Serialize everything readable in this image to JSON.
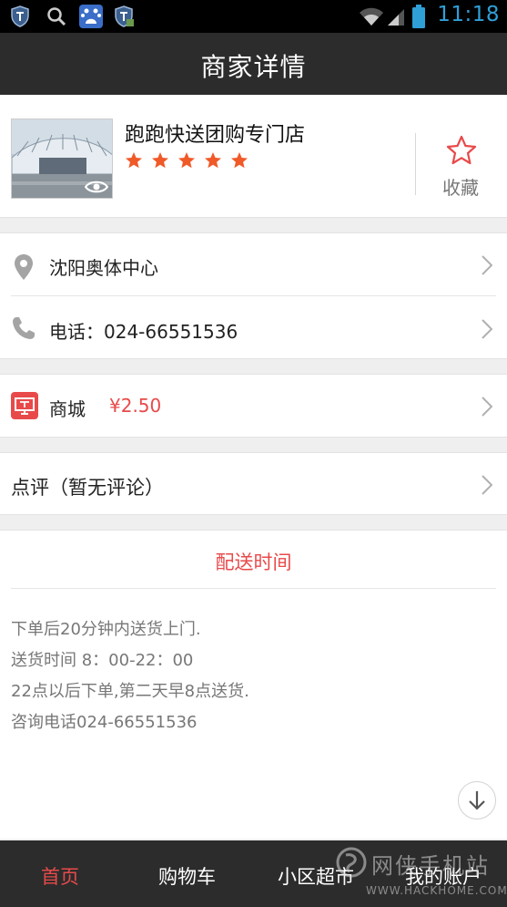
{
  "status_bar": {
    "time": "11:18",
    "left_icons": [
      "shield-icon",
      "search-icon",
      "baidu-icon",
      "shield-app-icon"
    ],
    "right_icons": [
      "wifi-icon",
      "signal-icon",
      "battery-icon"
    ]
  },
  "header": {
    "title": "商家详情"
  },
  "store": {
    "name": "跑跑快送团购专门店",
    "rating_stars": 5,
    "star_color": "#f05a28",
    "favorite_label": "收藏"
  },
  "location": {
    "label": "沈阳奥体中心"
  },
  "phone": {
    "label": "电话：024-66551536"
  },
  "mall": {
    "label": "商城",
    "price": "¥2.50"
  },
  "review": {
    "label": "点评（暂无评论）"
  },
  "delivery": {
    "title": "配送时间",
    "lines": [
      "下单后20分钟内送货上门.",
      "送货时间 8：00-22：00",
      "22点以后下单,第二天早8点送货.",
      "咨询电话024-66551536"
    ]
  },
  "bottom_nav": {
    "items": [
      "首页",
      "购物车",
      "小区超市",
      "我的账户"
    ],
    "active_index": 0
  },
  "watermark": {
    "cn": "网侠手机站",
    "en": "WWW.HACKHOME.COM"
  },
  "colors": {
    "accent": "#e84a4a",
    "bar": "#2c2c2c",
    "time": "#2f9fd8"
  }
}
